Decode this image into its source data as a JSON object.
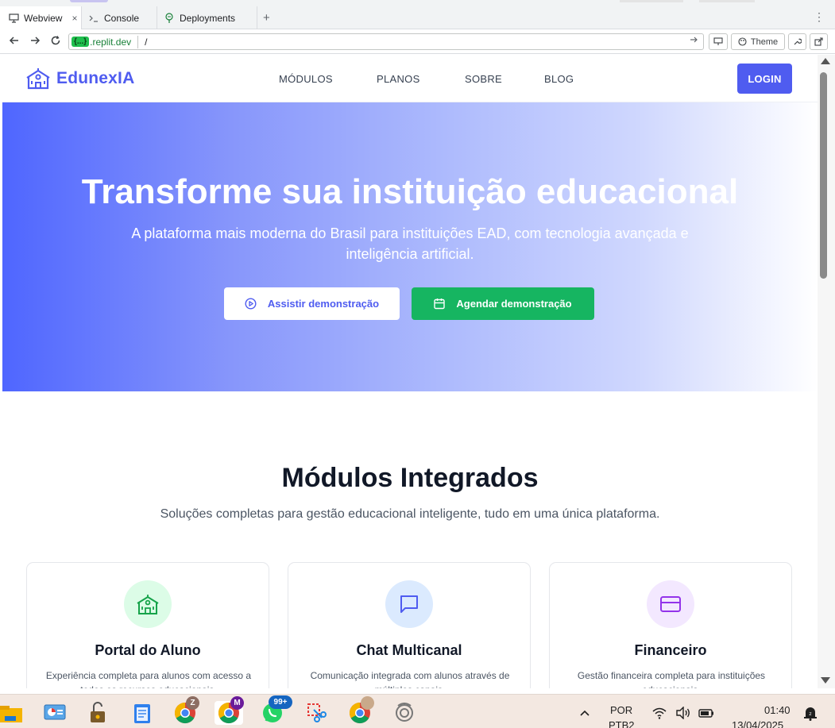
{
  "browser": {
    "tabs": [
      {
        "label": "Webview",
        "icon": "monitor-icon",
        "active": true
      },
      {
        "label": "Console",
        "icon": "terminal-icon",
        "active": false
      },
      {
        "label": "Deployments",
        "icon": "deploy-icon",
        "active": false
      }
    ],
    "close_glyph": "×",
    "add_tab_glyph": "+",
    "more_glyph": "⋮",
    "url": {
      "pill": "{...}",
      "domain": ".replit.dev",
      "path": "/"
    },
    "theme_label": "Theme"
  },
  "site": {
    "brand": "EdunexIA",
    "nav": [
      "MÓDULOS",
      "PLANOS",
      "SOBRE",
      "BLOG"
    ],
    "login_label": "LOGIN",
    "hero": {
      "title": "Transforme sua instituição educacional",
      "subtitle": "A plataforma mais moderna do Brasil para instituições EAD, com tecnologia avançada e inteligência artificial.",
      "demo_button": "Assistir demonstração",
      "schedule_button": "Agendar demonstração"
    },
    "modules": {
      "title": "Módulos Integrados",
      "subtitle": "Soluções completas para gestão educacional inteligente, tudo em uma única plataforma.",
      "cards": [
        {
          "title": "Portal do Aluno",
          "desc": "Experiência completa para alunos com acesso a todos os recursos educacionais.",
          "icon": "school-icon"
        },
        {
          "title": "Chat Multicanal",
          "desc": "Comunicação integrada com alunos através de múltiplos canais.",
          "icon": "chat-icon"
        },
        {
          "title": "Financeiro",
          "desc": "Gestão financeira completa para instituições educacionais.",
          "icon": "credit-card-icon"
        }
      ]
    }
  },
  "taskbar": {
    "badge_chrome_profile1": "Z",
    "badge_chrome_profile2": "M",
    "badge_whatsapp": "99+",
    "lang_top": "POR",
    "lang_bottom": "PTB2",
    "time": "01:40",
    "date": "13/04/2025"
  },
  "colors": {
    "brand": "#4f5cf0",
    "success": "#16b561"
  }
}
